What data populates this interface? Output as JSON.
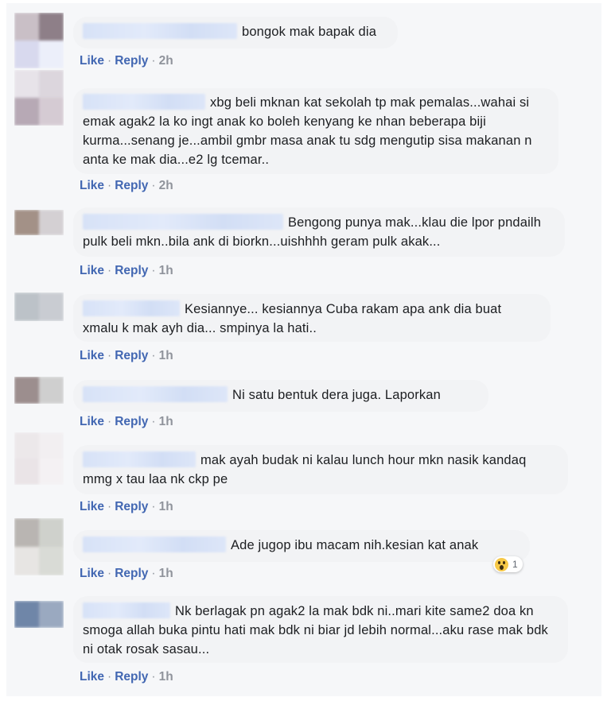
{
  "colors": {
    "link": "#4267b2",
    "meta": "#90949c",
    "bubble": "#f2f3f5",
    "background": "#f6f7f9"
  },
  "comments": [
    {
      "text": "bongok mak bapak dia",
      "actions": {
        "like": "Like",
        "reply": "Reply",
        "time": "2h"
      }
    },
    {
      "text": "xbg beli mknan kat sekolah tp mak pemalas...wahai si emak agak2 la ko ingt anak ko boleh kenyang ke nhan beberapa biji kurma...senang je...ambil gmbr masa anak tu sdg mengutip sisa makanan n anta ke mak dia...e2 lg tcemar..",
      "actions": {
        "like": "Like",
        "reply": "Reply",
        "time": "2h"
      }
    },
    {
      "text": "Bengong punya mak...klau die lpor pndailh pulk beli mkn..bila ank di biorkn...uishhhh geram pulk akak...",
      "actions": {
        "like": "Like",
        "reply": "Reply",
        "time": "1h"
      }
    },
    {
      "text": "Kesiannye... kesiannya Cuba rakam apa ank dia buat xmalu k mak ayh dia... smpinya la hati..",
      "actions": {
        "like": "Like",
        "reply": "Reply",
        "time": "1h"
      }
    },
    {
      "text": "Ni satu bentuk dera juga. Laporkan",
      "actions": {
        "like": "Like",
        "reply": "Reply",
        "time": "1h"
      }
    },
    {
      "text": "mak ayah budak ni kalau lunch hour mkn nasik kandaq mmg x tau laa nk ckp pe",
      "actions": {
        "like": "Like",
        "reply": "Reply",
        "time": "1h"
      }
    },
    {
      "text": "Ade jugop ibu macam nih.kesian kat anak",
      "actions": {
        "like": "Like",
        "reply": "Reply",
        "time": "1h"
      },
      "reaction": {
        "icon": "wow-reaction-icon",
        "count": "1"
      }
    },
    {
      "text": "Nk berlagak pn agak2 la mak bdk ni..mari kite same2 doa kn smoga allah buka pintu hati mak bdk ni biar jd lebih normal...aku rase mak bdk ni otak rosak sasau...",
      "actions": {
        "like": "Like",
        "reply": "Reply",
        "time": "1h"
      }
    }
  ]
}
